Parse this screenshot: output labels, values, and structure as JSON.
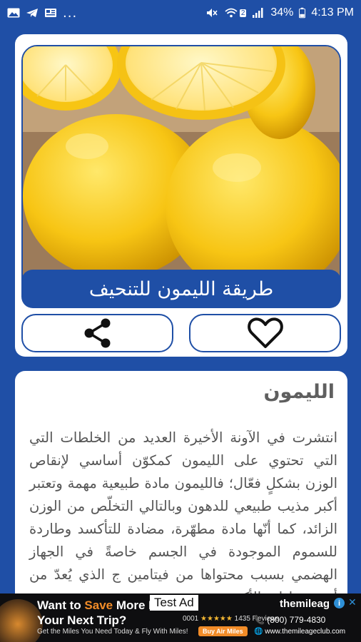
{
  "status_bar": {
    "dots": "...",
    "sim_badge": "2",
    "battery": "34%",
    "time": "4:13 PM",
    "icons": [
      "gallery-icon",
      "telegram-icon",
      "news-icon",
      "mute-icon",
      "wifi-icon",
      "signal-icon",
      "battery-icon"
    ]
  },
  "recipe": {
    "title": "طريقة الليمون للتنحيف",
    "image_subject": "lemons"
  },
  "actions": {
    "share_icon": "share-icon",
    "favorite_icon": "heart-icon"
  },
  "article": {
    "heading": "الليمون",
    "body": "انتشرت في الآونة الأخيرة العديد من الخلطات التي التي تحتوي على الليمون كمكوّن أساسي لإنقاص الوزن بشكلٍ فعّال؛ فالليمون مادة طبيعية مهمة وتعتبر أكبر مذيب طبيعي للدهون وبالتالي التخلّص من الوزن الزائد، كما أنّها مادة مطهّرة، مضادة للتأكسد وطاردة للسموم الموجودة في الجسم خاصةً في الجهاز الهضمي بسبب محتواها من فيتامين ج الذي يُعدّ من أهم مضادات الأكسدة"
  },
  "ad": {
    "headline_prefix": "Want to ",
    "headline_highlight": "Save",
    "headline_suffix": " More M",
    "headline_line2": "Your Next Trip?",
    "tag": "Test Ad",
    "subline": "Get the Miles You Need Today & Fly With Miles!",
    "reviews": "1435 Reviews",
    "reviews_prefix": "0001",
    "button": "Buy Air Miles",
    "brand": "themileag",
    "phone": "(800) 779-4830",
    "url": "www.themileageclub.com",
    "colors": {
      "accent": "#f28c28",
      "info": "#2e8fd6"
    }
  },
  "colors": {
    "primary": "#1f4fa6",
    "card": "#ffffff",
    "text": "#555555"
  }
}
